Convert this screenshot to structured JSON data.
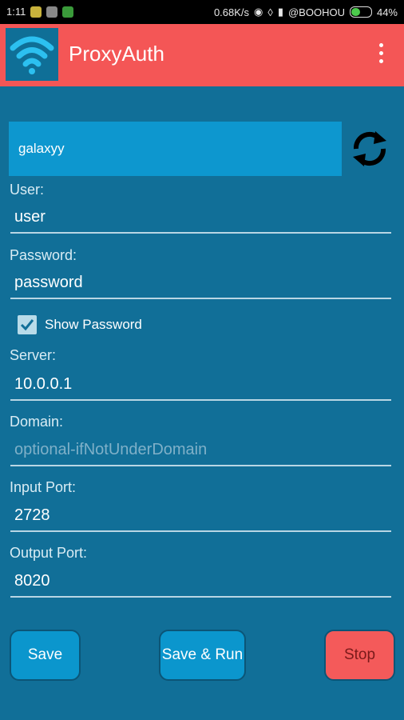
{
  "status_bar": {
    "time": "1:11",
    "network_speed": "0.68K/s",
    "carrier": "@BOOHOU",
    "battery": "44%"
  },
  "app_bar": {
    "title": "ProxyAuth",
    "logo_icon": "wifi-icon",
    "overflow_icon": "more-vert-icon"
  },
  "profile": {
    "value": "galaxyy",
    "refresh_icon": "sync-icon"
  },
  "form": {
    "user": {
      "label": "User:",
      "value": "user"
    },
    "password": {
      "label": "Password:",
      "value": "password"
    },
    "show_password": {
      "label": "Show Password",
      "checked": true
    },
    "server": {
      "label": "Server:",
      "value": "10.0.0.1"
    },
    "domain": {
      "label": "Domain:",
      "placeholder": "optional-ifNotUnderDomain"
    },
    "input_port": {
      "label": "Input Port:",
      "value": "2728"
    },
    "output_port": {
      "label": "Output Port:",
      "value": "8020"
    }
  },
  "buttons": {
    "save": "Save",
    "save_run": "Save & Run",
    "stop": "Stop"
  },
  "colors": {
    "background": "#116f98",
    "app_bar": "#f45656",
    "accent_blue": "#0d97cf",
    "stop_button": "#f45a5a"
  }
}
